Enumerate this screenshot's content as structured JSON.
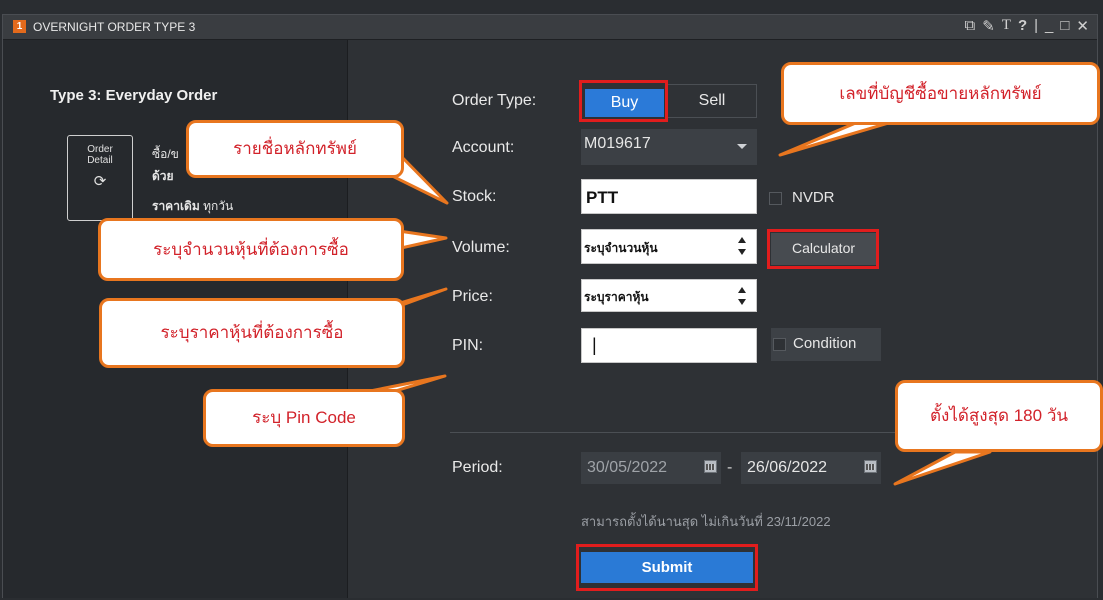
{
  "window": {
    "number": "1",
    "title": "OVERNIGHT ORDER TYPE 3",
    "icons": [
      "popout-icon",
      "pin-icon",
      "text-icon",
      "help-icon",
      "separator",
      "minimize-icon",
      "maximize-icon",
      "close-icon"
    ],
    "icon_glyphs": {
      "popout": "⧉",
      "pin": "✎",
      "text": "T",
      "help": "?",
      "sep": "|",
      "minimize": "_",
      "maximize": "□",
      "close": "✕"
    }
  },
  "left": {
    "type_title": "Type 3: Everyday Order",
    "card_line1": "Order",
    "card_line2": "Detail",
    "card_icon": "⟳",
    "desc_line1": "ซื้อ/ข",
    "desc_line2": "ด้วย",
    "desc_line3_bold": "ราคาเดิม",
    "desc_line3_rest": " ทุกวัน"
  },
  "form": {
    "order_type_label": "Order Type:",
    "buy_label": "Buy",
    "sell_label": "Sell",
    "account_label": "Account:",
    "account_value": "M019617",
    "stock_label": "Stock:",
    "stock_value": "PTT",
    "nvdr_label": "NVDR",
    "volume_label": "Volume:",
    "volume_value": "ระบุจำนวนหุ้น",
    "calculator_label": "Calculator",
    "price_label": "Price:",
    "price_value": "ระบุราคาหุ้น",
    "pin_label": "PIN:",
    "pin_value": "|",
    "condition_label": "Condition",
    "period_label": "Period:",
    "date_from": "30/05/2022",
    "date_dash": "-",
    "date_to": "26/06/2022",
    "period_hint": "สามารถตั้งได้นานสุด ไม่เกินวันที่ 23/11/2022",
    "submit_label": "Submit"
  },
  "callouts": {
    "account": "เลขที่บัญชีซื้อขายหลักทรัพย์",
    "stock": "รายชื่อหลักทรัพย์",
    "volume": "ระบุจำนวนหุ้นที่ต้องการซื้อ",
    "price": "ระบุราคาหุ้นที่ต้องการซื้อ",
    "pin": "ระบุ Pin  Code",
    "period": "ตั้งได้สูงสุด 180 วัน"
  },
  "colors": {
    "accent_blue": "#2b7ad8",
    "highlight_red": "#e11d1d",
    "callout_border": "#e8761f",
    "callout_text": "#d2222a",
    "title_badge": "#e36a1c"
  }
}
